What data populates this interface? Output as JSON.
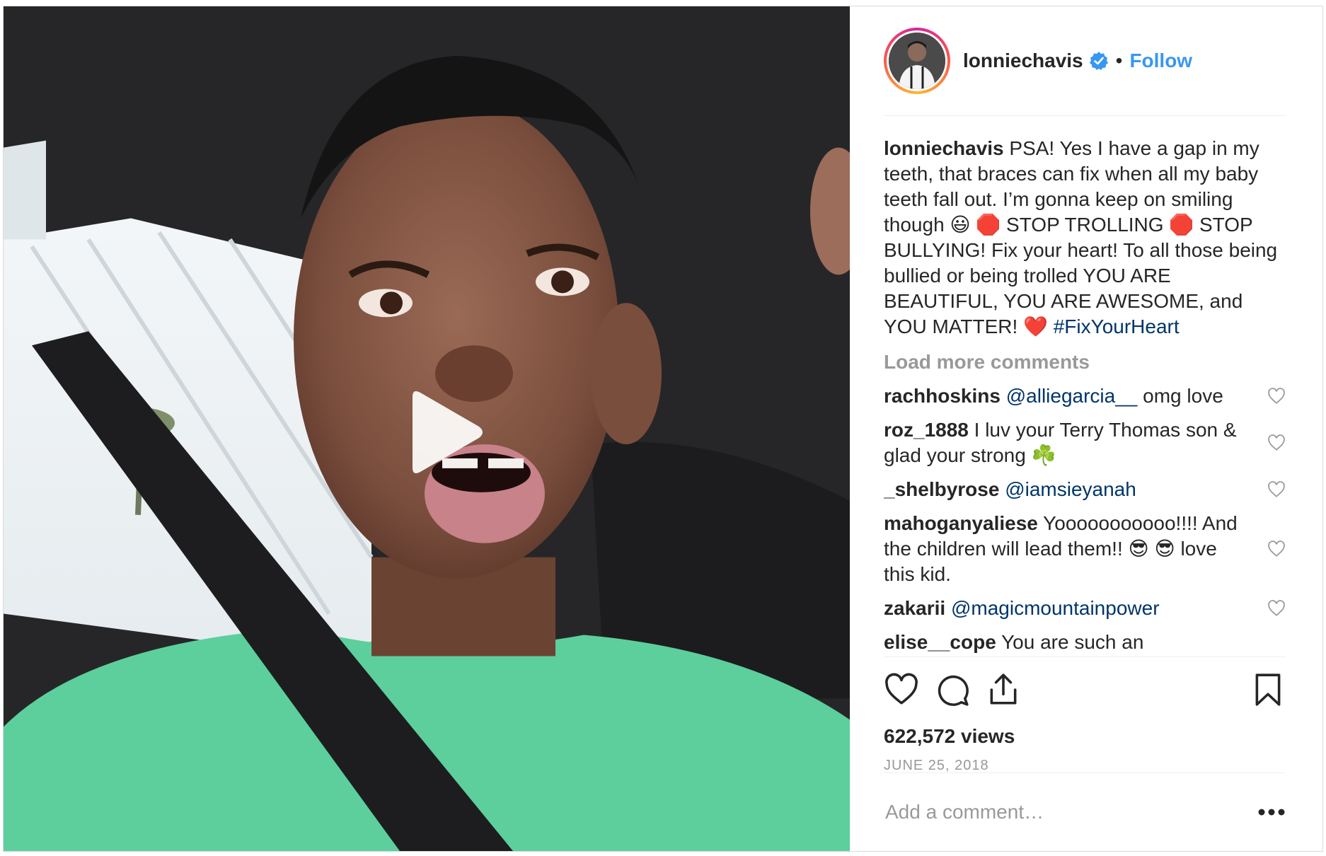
{
  "header": {
    "username": "lonniechavis",
    "dot": "•",
    "follow_label": "Follow"
  },
  "caption": {
    "username": "lonniechavis",
    "text": "PSA! Yes I have a gap in my teeth, that braces can fix when all my baby teeth fall out. I’m gonna keep on smiling though 😃 🛑 STOP TROLLING 🛑 STOP BULLYING! Fix your heart! To all those being bullied or being trolled YOU ARE BEAUTIFUL, YOU ARE AWESOME, and YOU MATTER! ❤️",
    "hashtag": "#FixYourHeart"
  },
  "load_more_label": "Load more comments",
  "comments": [
    {
      "username": "rachhoskins",
      "mention": "@alliegarcia__",
      "text": "omg love"
    },
    {
      "username": "roz_1888",
      "mention": "",
      "text": "I luv your Terry Thomas son & glad your strong ☘️"
    },
    {
      "username": "_shelbyrose",
      "mention": "@iamsieyanah",
      "text": ""
    },
    {
      "username": "mahoganyaliese",
      "mention": "",
      "text": "Yooooooooooo!!!! And the children will lead them!! 😎 😎  love this kid."
    },
    {
      "username": "zakarii",
      "mention": "@magicmountainpower",
      "text": ""
    },
    {
      "username": "elise__cope",
      "mention": "",
      "text": "You are such an"
    }
  ],
  "stats": {
    "views": "622,572 views",
    "date": "JUNE 25, 2018"
  },
  "add_comment": {
    "placeholder": "Add a comment…"
  },
  "icons": {
    "like": "heart-outline-icon",
    "comment": "speech-bubble-icon",
    "share": "share-upload-icon",
    "save": "bookmark-icon",
    "verified": "verified-badge-icon",
    "play": "play-icon",
    "more": "ellipsis-icon"
  },
  "colors": {
    "link": "#3897f0",
    "hashtag": "#003569",
    "muted": "#999999",
    "text": "#262626"
  }
}
